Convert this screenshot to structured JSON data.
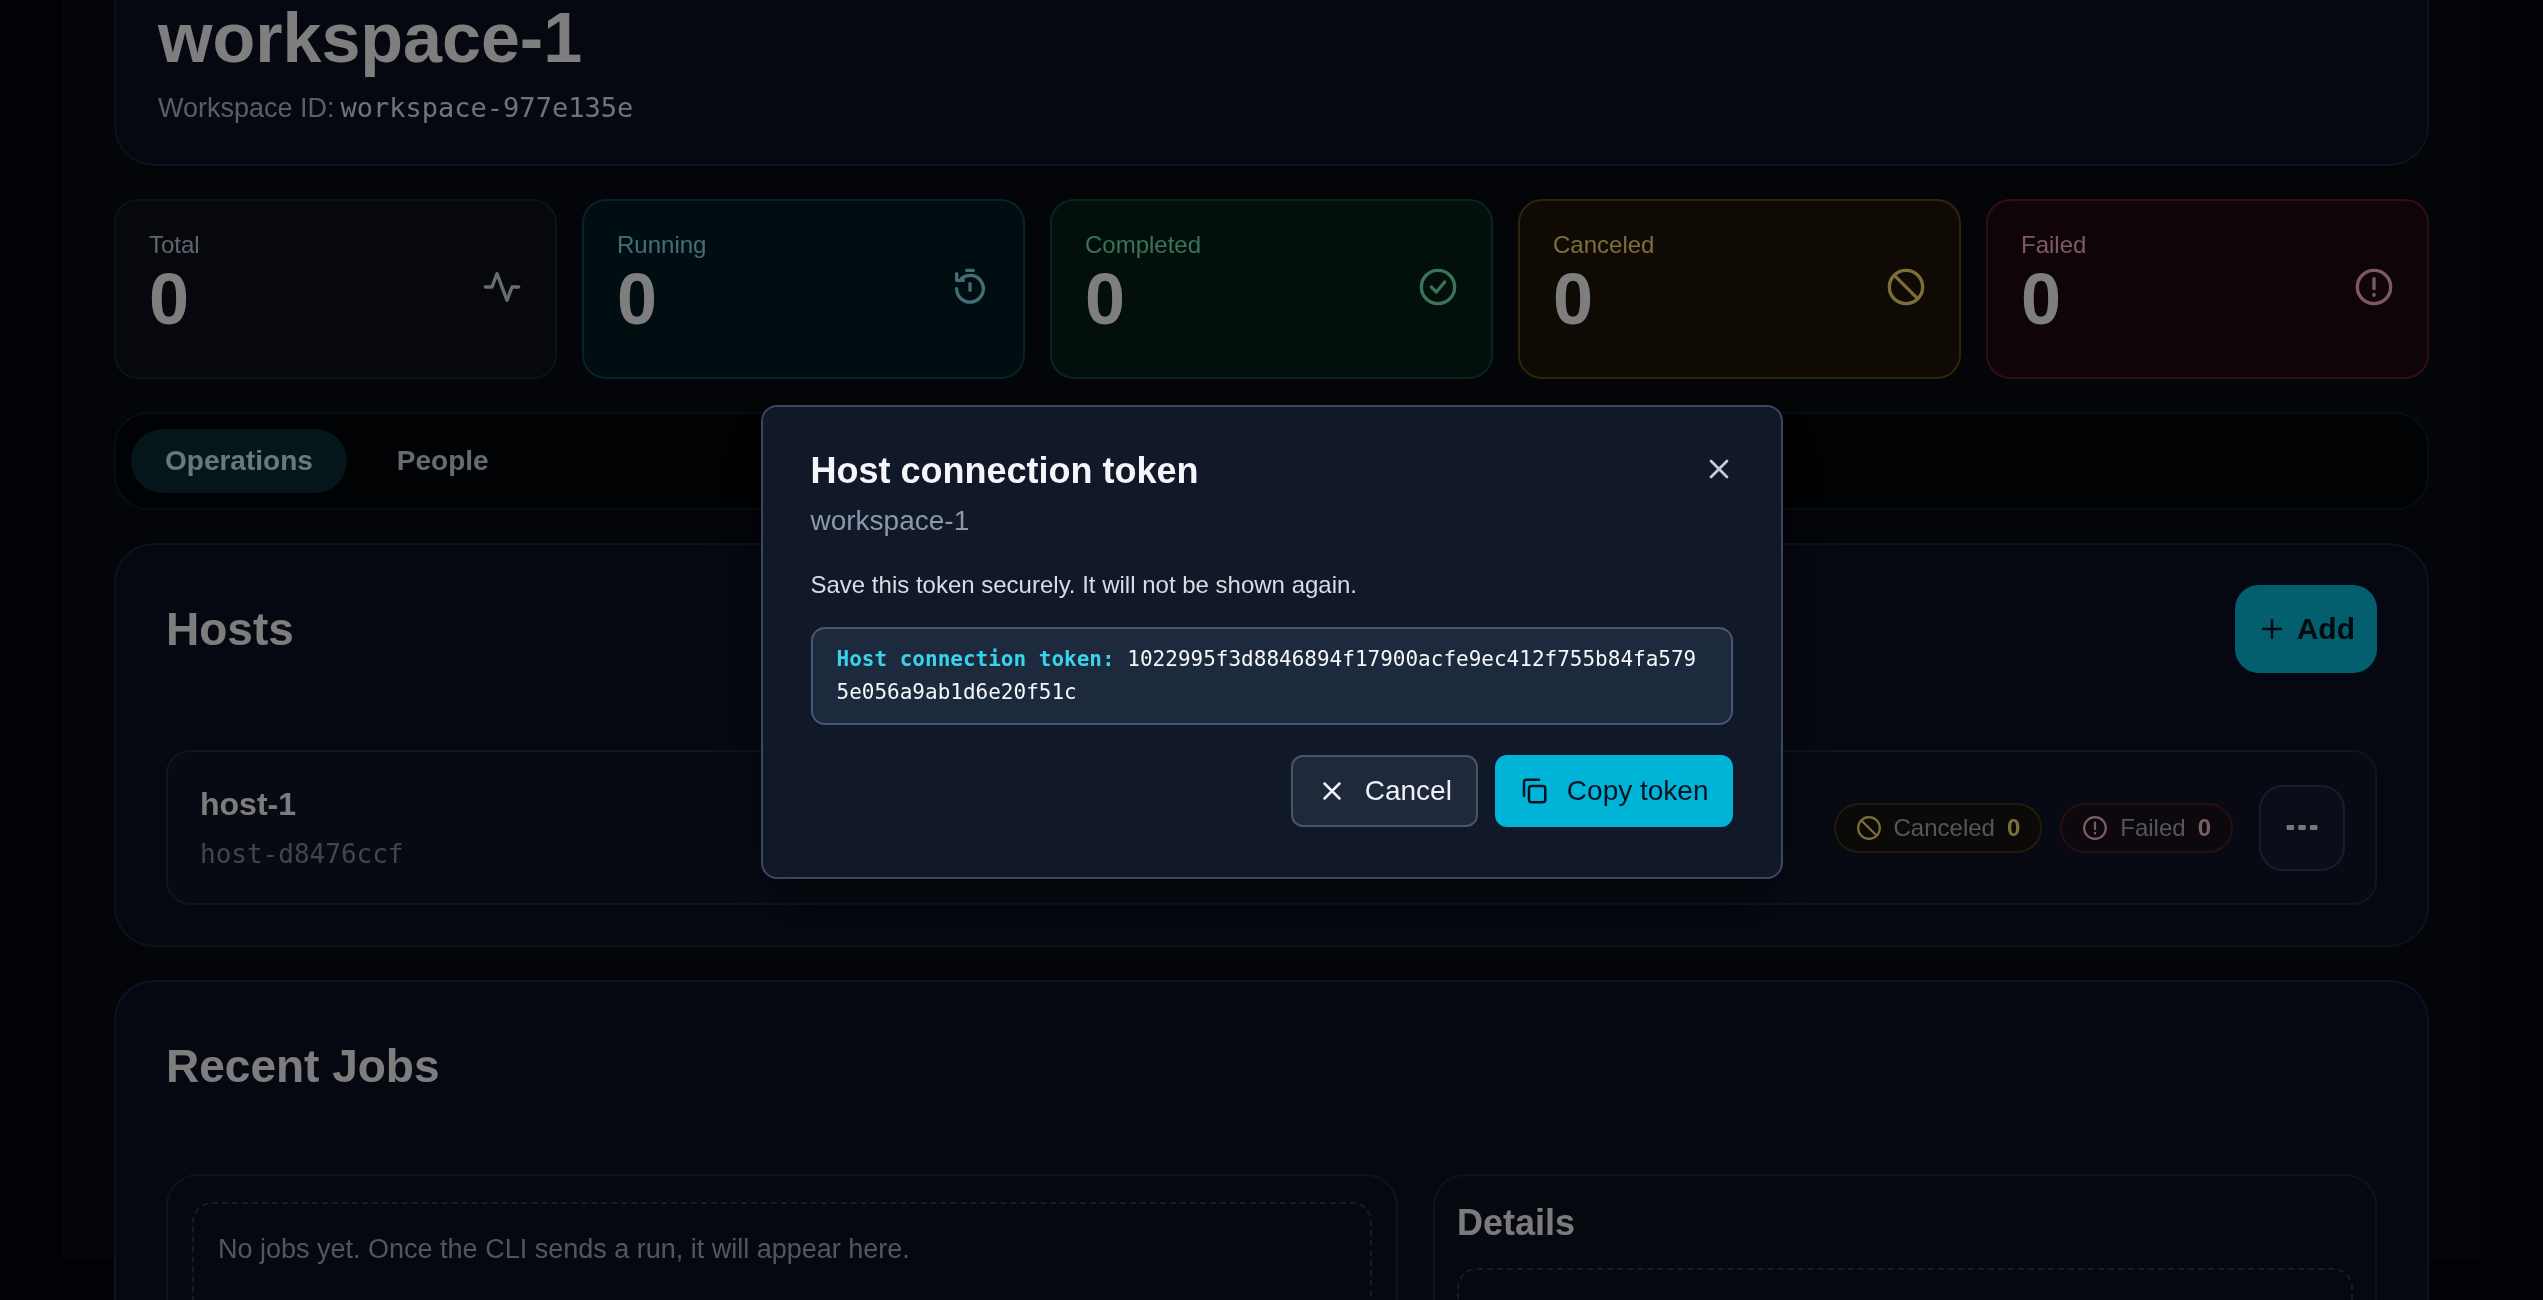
{
  "workspace": {
    "title": "workspace-1",
    "id_label": "Workspace ID:",
    "id": "workspace-977e135e"
  },
  "stats": [
    {
      "kind": "total",
      "label": "Total",
      "value": "0"
    },
    {
      "kind": "running",
      "label": "Running",
      "value": "0"
    },
    {
      "kind": "completed",
      "label": "Completed",
      "value": "0"
    },
    {
      "kind": "canceled",
      "label": "Canceled",
      "value": "0"
    },
    {
      "kind": "failed",
      "label": "Failed",
      "value": "0"
    }
  ],
  "tabs": [
    {
      "label": "Operations",
      "selected": true
    },
    {
      "label": "People",
      "selected": false
    }
  ],
  "hosts": {
    "title": "Hosts",
    "add_button": "Add",
    "items": [
      {
        "name": "host-1",
        "id": "host-d8476ccf",
        "badges": [
          {
            "kind": "canceled",
            "label": "Canceled",
            "count": "0"
          },
          {
            "kind": "failed",
            "label": "Failed",
            "count": "0"
          }
        ]
      }
    ]
  },
  "recent_jobs": {
    "title": "Recent Jobs",
    "empty_message": "No jobs yet. Once the CLI sends a run, it will appear here.",
    "details_title": "Details"
  },
  "dialog": {
    "title": "Host connection token",
    "subtitle": "workspace-1",
    "message": "Save this token securely. It will not be shown again.",
    "token_label": "Host connection token:",
    "token": "1022995f3d8846894f17900acfe9ec412f755b84fa5795e056a9ab1d6e20f51c",
    "buttons": [
      {
        "kind": "cancel",
        "label": "Cancel"
      },
      {
        "kind": "copy",
        "label": "Copy token"
      }
    ]
  }
}
